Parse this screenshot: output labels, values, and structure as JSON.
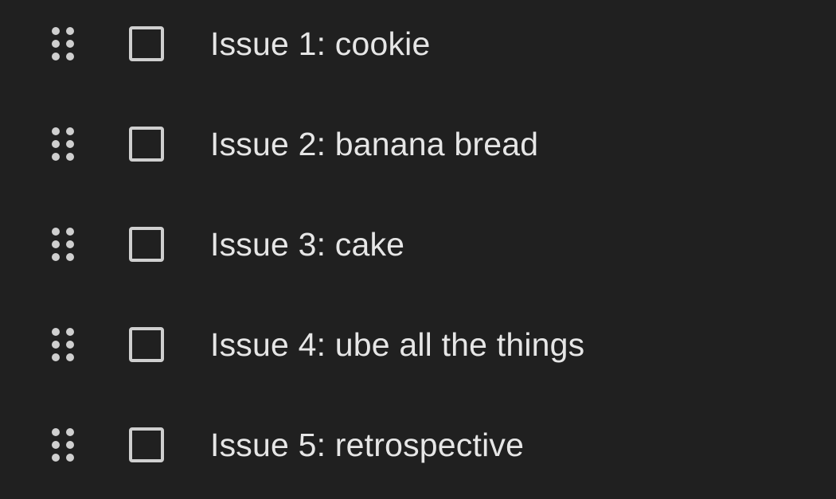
{
  "issues": [
    {
      "label": "Issue 1: cookie",
      "checked": false
    },
    {
      "label": "Issue 2: banana bread",
      "checked": false
    },
    {
      "label": "Issue 3: cake",
      "checked": false
    },
    {
      "label": "Issue 4: ube all the things",
      "checked": false
    },
    {
      "label": "Issue 5: retrospective",
      "checked": false
    }
  ],
  "icons": {
    "drag": "drag-indicator-icon",
    "checkbox": "checkbox-unchecked-icon"
  },
  "colors": {
    "background": "#202020",
    "text": "#e6e6e6",
    "icon": "#cfcfcf"
  }
}
